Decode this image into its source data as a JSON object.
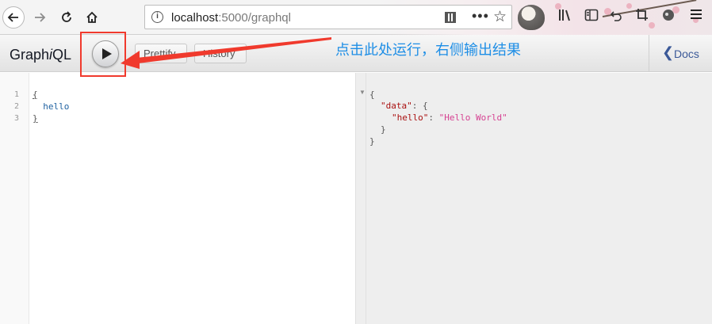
{
  "browser": {
    "url_host": "localhost",
    "url_port": ":5000",
    "url_path": "/graphql",
    "icons": [
      "back-arrow-icon",
      "forward-arrow-icon",
      "reload-icon",
      "home-icon",
      "info-icon",
      "qr-code-icon",
      "more-dots-icon",
      "bookmark-star-icon",
      "library-icon",
      "sidebar-icon",
      "screenshot-icon",
      "menu-icon"
    ]
  },
  "graphiql": {
    "title_prefix": "Graph",
    "title_i": "i",
    "title_suffix": "QL",
    "run_icon": "play-icon",
    "prettify_label": "Prettify",
    "history_label": "History",
    "docs_label": "Docs"
  },
  "annotation": {
    "text": "点击此处运行，右侧输出结果",
    "color": "#1e8ee6",
    "arrow_color": "#f03a2d"
  },
  "query_editor": {
    "line_numbers": [
      "1",
      "2",
      "3"
    ],
    "lines": [
      "{",
      "  hello",
      "}"
    ]
  },
  "result": {
    "line1": "{",
    "data_key": "\"data\"",
    "data_open": ": {",
    "hello_key": "\"hello\"",
    "colon": ": ",
    "hello_value": "\"Hello World\"",
    "inner_close": "}",
    "outer_close": "}"
  }
}
